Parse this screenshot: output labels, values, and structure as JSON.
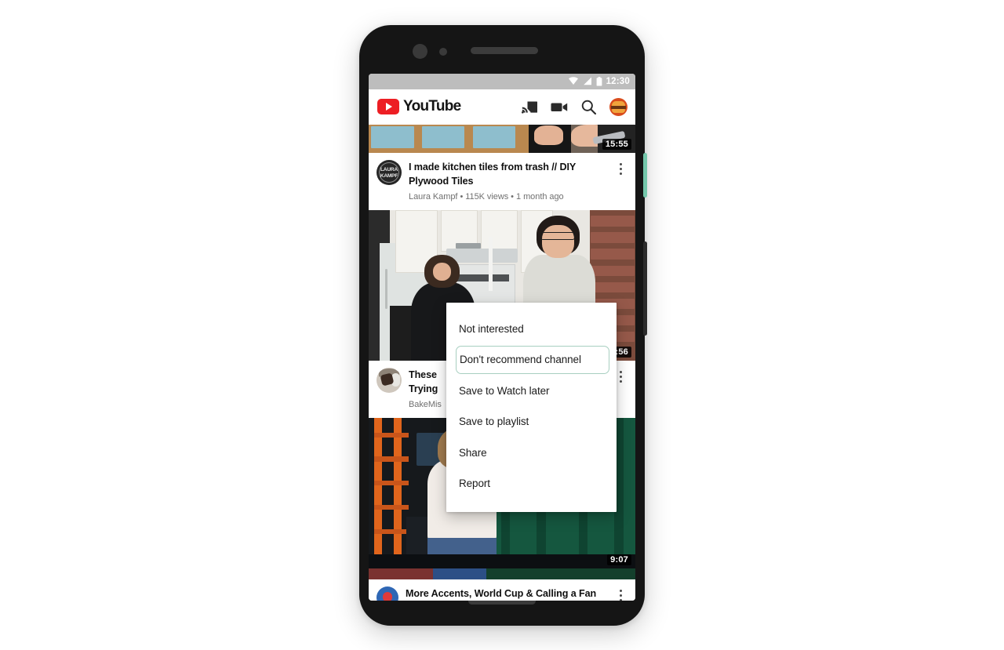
{
  "device": {
    "type": "android-phone",
    "power_button_color": "#74c7ab",
    "volume_button_color": "#2b2b2b"
  },
  "status_bar": {
    "time": "12:30",
    "icons": [
      "wifi-icon",
      "cellular-signal-icon",
      "battery-icon"
    ],
    "background": "#bdbdbd"
  },
  "appbar": {
    "logo_text": "YouTube",
    "logo_color": "#ed1e24",
    "actions": [
      {
        "name": "cast-icon",
        "label": "Cast"
      },
      {
        "name": "create-video-icon",
        "label": "Create"
      },
      {
        "name": "search-icon",
        "label": "Search"
      },
      {
        "name": "account-avatar",
        "label": "Account"
      }
    ]
  },
  "feed": {
    "videos": [
      {
        "title": "I made kitchen tiles from trash // DIY Plywood Tiles",
        "channel": "Laura Kampf",
        "views": "115K views",
        "age": "1 month ago",
        "meta_line": "Laura Kampf • 115K views • 1 month ago",
        "duration": "15:55",
        "avatar_line1": "LAURA",
        "avatar_line2": "KAMPF"
      },
      {
        "title_fragment_1": "These",
        "title_fragment_2": "Trying",
        "channel_fragment": "BakeMis",
        "duration": ":56"
      },
      {
        "duration": "9:07"
      },
      {
        "title": "More Accents, World Cup & Calling a Fan"
      }
    ]
  },
  "context_menu": {
    "items": [
      {
        "label": "Not interested",
        "focused": false
      },
      {
        "label": "Don't recommend channel",
        "focused": true
      },
      {
        "label": "Save to Watch later",
        "focused": false
      },
      {
        "label": "Save to playlist",
        "focused": false
      },
      {
        "label": "Share",
        "focused": false
      },
      {
        "label": "Report",
        "focused": false
      }
    ],
    "focus_border_color": "#a8cfc0"
  }
}
